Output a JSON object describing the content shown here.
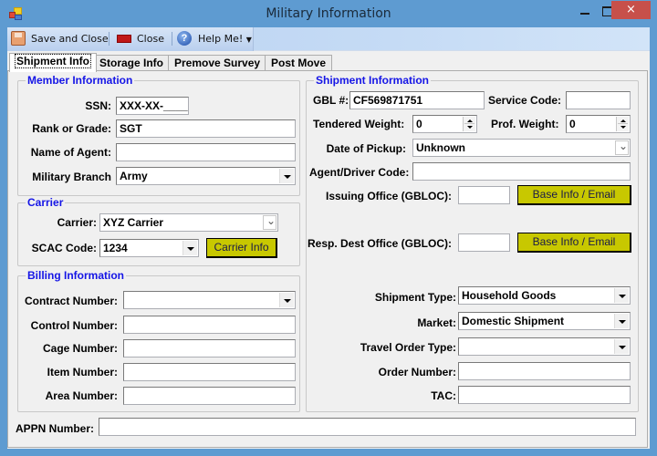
{
  "window": {
    "title": "Military Information",
    "controls": {
      "minimize": "minimize",
      "maximize": "maximize",
      "close": "×"
    }
  },
  "toolbar": {
    "save_close_label": "Save and Close",
    "close_label": "Close",
    "help_label": "Help Me!",
    "help_icon_glyph": "?"
  },
  "tabs": [
    {
      "label": "Shipment Info",
      "active": true
    },
    {
      "label": "Storage Info",
      "active": false
    },
    {
      "label": "Premove Survey",
      "active": false
    },
    {
      "label": "Post Move",
      "active": false
    }
  ],
  "member": {
    "title": "Member Information",
    "ssn_label": "SSN:",
    "ssn_value": "XXX-XX-____",
    "rank_label": "Rank or Grade:",
    "rank_value": "SGT",
    "agent_label": "Name of Agent:",
    "agent_value": "",
    "branch_label": "Military Branch",
    "branch_value": "Army"
  },
  "carrier": {
    "title": "Carrier",
    "carrier_label": "Carrier:",
    "carrier_value": "XYZ Carrier",
    "scac_label": "SCAC Code:",
    "scac_value": "1234",
    "info_button": "Carrier Info"
  },
  "billing": {
    "title": "Billing Information",
    "contract_label": "Contract Number:",
    "contract_value": "",
    "control_label": "Control Number:",
    "control_value": "",
    "cage_label": "Cage Number:",
    "cage_value": "",
    "item_label": "Item Number:",
    "item_value": "",
    "area_label": "Area Number:",
    "area_value": ""
  },
  "shipment": {
    "title": "Shipment Information",
    "gbl_label": "GBL #:",
    "gbl_value": "CF569871751",
    "service_code_label": "Service Code:",
    "service_code_value": "",
    "tendered_weight_label": "Tendered Weight:",
    "tendered_weight_value": "0",
    "prof_weight_label": "Prof. Weight:",
    "prof_weight_value": "0",
    "pickup_label": "Date of Pickup:",
    "pickup_value": "Unknown",
    "agent_driver_label": "Agent/Driver Code:",
    "agent_driver_value": "",
    "issuing_label": "Issuing Office (GBLOC):",
    "issuing_value": "",
    "issuing_button": "Base Info / Email",
    "resp_dest_label": "Resp. Dest Office (GBLOC):",
    "resp_dest_value": "",
    "resp_dest_button": "Base Info / Email",
    "shipment_type_label": "Shipment Type:",
    "shipment_type_value": "Household Goods",
    "market_label": "Market:",
    "market_value": "Domestic Shipment",
    "travel_order_label": "Travel Order Type:",
    "travel_order_value": "",
    "order_number_label": "Order Number:",
    "order_number_value": "",
    "tac_label": "TAC:",
    "tac_value": ""
  },
  "appn": {
    "label": "APPN Number:",
    "value": ""
  },
  "colors": {
    "group_title": "#1515e6",
    "yellow_button": "#c8c800",
    "window_frame": "#5e9bd1",
    "close_button": "#c7504a"
  }
}
